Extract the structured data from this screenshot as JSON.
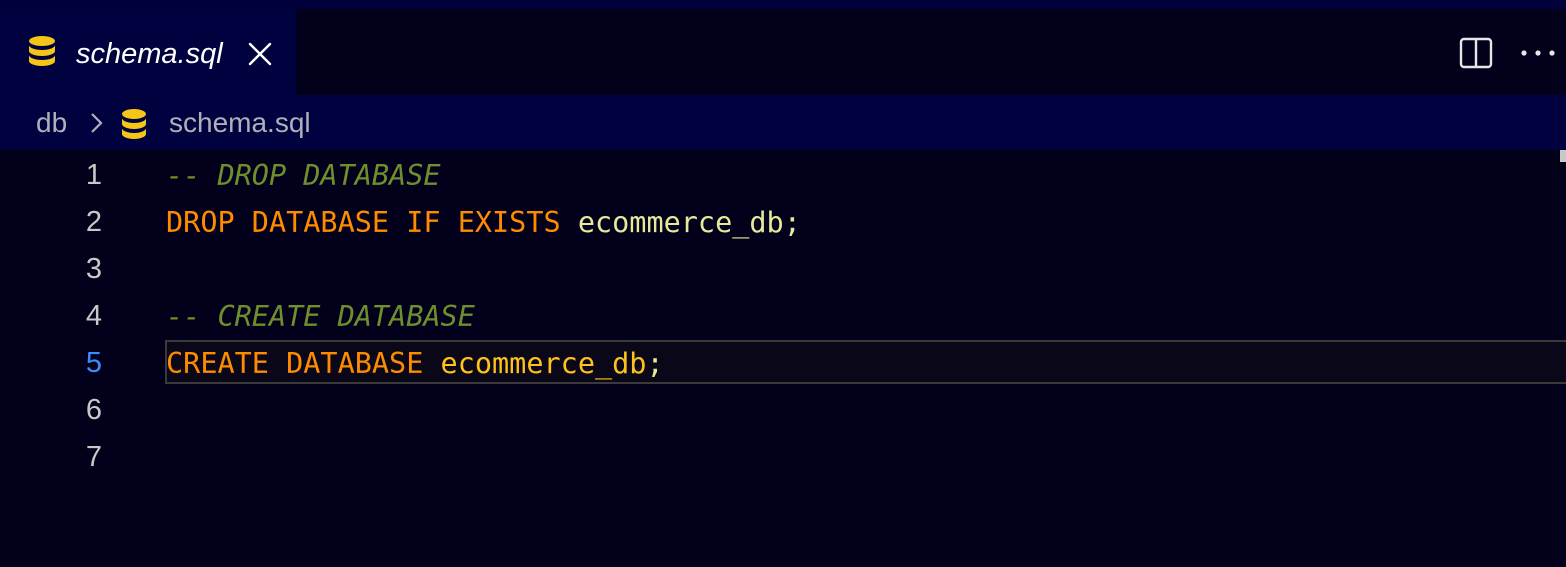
{
  "tab": {
    "title": "schema.sql",
    "icon": "database-icon",
    "close_icon": "close-icon"
  },
  "actions": {
    "split_icon": "split-editor-icon",
    "more_icon": "more-actions-icon"
  },
  "breadcrumb": {
    "folder": "db",
    "separator_icon": "chevron-right-icon",
    "file_icon": "database-icon",
    "file": "schema.sql"
  },
  "editor": {
    "active_line": 5,
    "lines": [
      {
        "number": "1",
        "tokens": [
          {
            "type": "comment",
            "text": "-- DROP DATABASE"
          }
        ]
      },
      {
        "number": "2",
        "tokens": [
          {
            "type": "kw",
            "text": "DROP DATABASE IF EXISTS"
          },
          {
            "type": "ident",
            "text": " ecommerce_db"
          },
          {
            "type": "punct",
            "text": ";"
          }
        ]
      },
      {
        "number": "3",
        "tokens": []
      },
      {
        "number": "4",
        "tokens": [
          {
            "type": "comment",
            "text": "-- CREATE DATABASE"
          }
        ]
      },
      {
        "number": "5",
        "tokens": [
          {
            "type": "kw",
            "text": "CREATE DATABASE"
          },
          {
            "type": "ident-active",
            "text": " ecommerce_db"
          },
          {
            "type": "punct",
            "text": ";"
          }
        ]
      },
      {
        "number": "6",
        "tokens": []
      },
      {
        "number": "7",
        "tokens": []
      }
    ]
  },
  "colors": {
    "background": "#02001a",
    "tab_active_bg": "#00013f",
    "keyword": "#ff8c00",
    "identifier": "#e6e89b",
    "comment": "#6f8f2c",
    "active_line_number": "#3b8cff"
  }
}
